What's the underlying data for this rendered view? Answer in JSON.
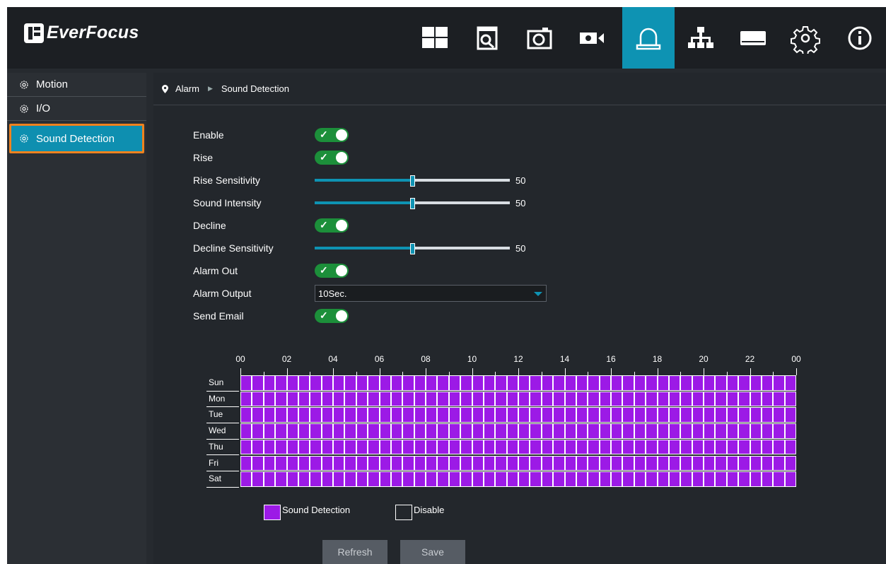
{
  "app": {
    "brand": "EverFocus"
  },
  "colors": {
    "accent": "#0e93b3",
    "toggle_on": "#1c8f3a",
    "schedule_fill": "#9c1ae6",
    "highlight_border": "#f0821e"
  },
  "nav": {
    "items": [
      {
        "icon": "layout-grid-icon"
      },
      {
        "icon": "playback-search-icon"
      },
      {
        "icon": "camera-icon"
      },
      {
        "icon": "record-icon"
      },
      {
        "icon": "alarm-icon",
        "active": true
      },
      {
        "icon": "network-icon"
      },
      {
        "icon": "storage-icon"
      },
      {
        "icon": "settings-icon"
      },
      {
        "icon": "info-icon"
      }
    ]
  },
  "sidebar": {
    "items": [
      {
        "label": "Motion"
      },
      {
        "label": "I/O"
      },
      {
        "label": "Sound Detection",
        "active": true
      }
    ]
  },
  "breadcrumb": {
    "root": "Alarm",
    "current": "Sound Detection"
  },
  "form": {
    "enable": {
      "label": "Enable",
      "on": true
    },
    "rise": {
      "label": "Rise",
      "on": true
    },
    "rise_sensitivity": {
      "label": "Rise Sensitivity",
      "value": 50
    },
    "sound_intensity": {
      "label": "Sound Intensity",
      "value": 50
    },
    "decline": {
      "label": "Decline",
      "on": true
    },
    "decline_sensitivity": {
      "label": "Decline Sensitivity",
      "value": 50
    },
    "alarm_out": {
      "label": "Alarm Out",
      "on": true
    },
    "alarm_output": {
      "label": "Alarm Output",
      "value": "10Sec."
    },
    "send_email": {
      "label": "Send Email",
      "on": true
    }
  },
  "schedule": {
    "hour_labels": [
      "00",
      "02",
      "04",
      "06",
      "08",
      "10",
      "12",
      "14",
      "16",
      "18",
      "20",
      "22",
      "00"
    ],
    "days": [
      "Sun",
      "Mon",
      "Tue",
      "Wed",
      "Thu",
      "Fri",
      "Sat"
    ],
    "slots_per_day": 48,
    "all_enabled": true
  },
  "legend": {
    "sound_detection": "Sound Detection",
    "disable": "Disable"
  },
  "buttons": {
    "refresh": "Refresh",
    "save": "Save"
  }
}
